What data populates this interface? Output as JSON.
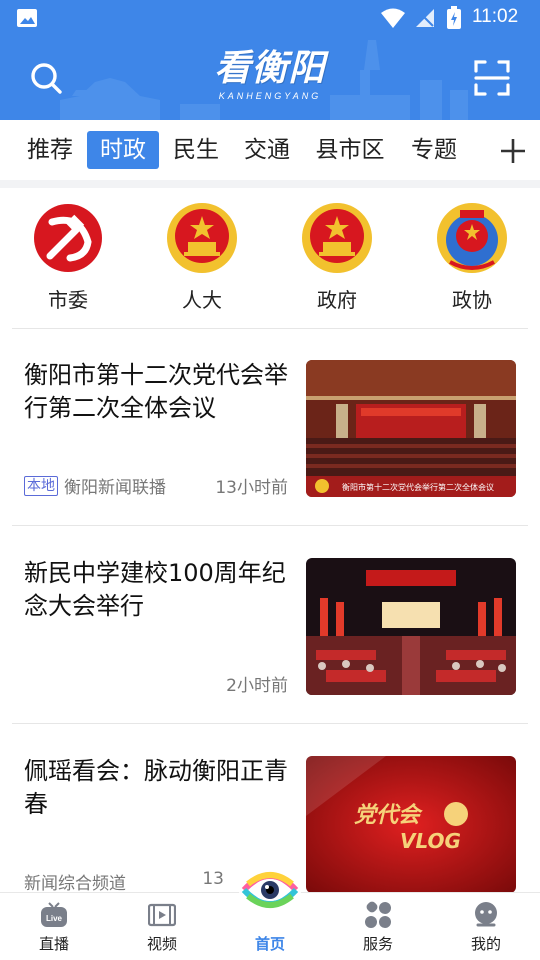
{
  "status_bar": {
    "time": "11:02"
  },
  "header": {
    "logo_text": "看衡阳",
    "logo_subtext": "KANHENGYANG",
    "search_icon": "search-icon",
    "scan_icon": "scan-icon"
  },
  "tabs": [
    {
      "label": "推荐",
      "active": false
    },
    {
      "label": "时政",
      "active": true
    },
    {
      "label": "民生",
      "active": false
    },
    {
      "label": "交通",
      "active": false
    },
    {
      "label": "县市区",
      "active": false
    },
    {
      "label": "专题",
      "active": false
    }
  ],
  "emblems": [
    {
      "label": "市委",
      "icon": "party-emblem-icon"
    },
    {
      "label": "人大",
      "icon": "national-emblem-icon"
    },
    {
      "label": "政府",
      "icon": "national-emblem-icon"
    },
    {
      "label": "政协",
      "icon": "cppcc-emblem-icon"
    }
  ],
  "news": [
    {
      "title": "衡阳市第十二次党代会举行第二次全体会议",
      "tag": "本地",
      "source": "衡阳新闻联播",
      "time": "13小时前",
      "thumb_caption": "衡阳市第十二次党代会举行第二次全体会议"
    },
    {
      "title": "新民中学建校100周年纪念大会举行",
      "tag": "",
      "source": "",
      "time": "2小时前"
    },
    {
      "title": "佩瑶看会：脉动衡阳正青春",
      "tag": "",
      "source": "新闻综合频道",
      "time": "13",
      "thumb_caption_main": "党代会",
      "thumb_caption_sub": "VLOG"
    }
  ],
  "bottom_nav": [
    {
      "label": "直播",
      "icon": "live-tv-icon",
      "active": false
    },
    {
      "label": "视频",
      "icon": "video-icon",
      "active": false
    },
    {
      "label": "首页",
      "icon": "home-eye-icon",
      "active": true
    },
    {
      "label": "服务",
      "icon": "services-icon",
      "active": false
    },
    {
      "label": "我的",
      "icon": "profile-icon",
      "active": false
    }
  ],
  "colors": {
    "primary": "#3e86e8",
    "tag_border": "#5b6bd8",
    "party_red": "#d7171f",
    "emblem_gold": "#f2c12e"
  }
}
